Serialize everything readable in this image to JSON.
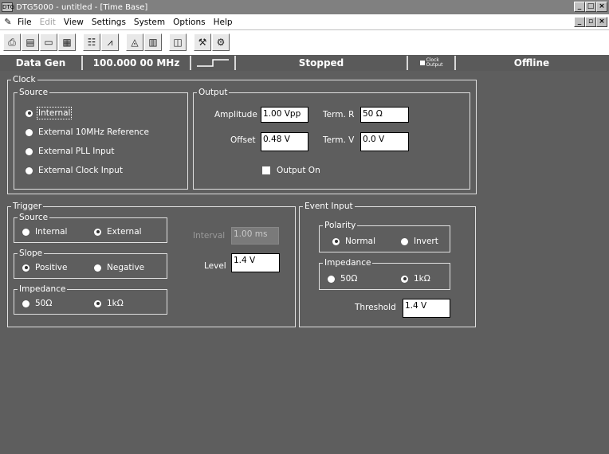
{
  "window": {
    "title": "DTG5000 - untitled - [Time Base]",
    "app_icon": "DTG",
    "controls": [
      "_",
      "□",
      "×"
    ],
    "mdi_controls": [
      "_",
      "▫",
      "×"
    ]
  },
  "menu": [
    {
      "label": "File",
      "enabled": true
    },
    {
      "label": "Edit",
      "enabled": false
    },
    {
      "label": "View",
      "enabled": true
    },
    {
      "label": "Settings",
      "enabled": true
    },
    {
      "label": "System",
      "enabled": true
    },
    {
      "label": "Options",
      "enabled": true
    },
    {
      "label": "Help",
      "enabled": true
    }
  ],
  "toolbar": {
    "icons": [
      "printer-icon",
      "print-preview-icon",
      "open-icon",
      "grid-icon",
      "channel-list-icon",
      "waveform-icon",
      "pattern-editor-icon",
      "sequence-icon",
      "blocks-icon",
      "tools-icon",
      "wrench-icon"
    ]
  },
  "status": {
    "mode": "Data Gen",
    "frequency": "100.000 00 MHz",
    "run_state": "Stopped",
    "clock_output_line1": "Clock",
    "clock_output_line2": "Output",
    "connection": "Offline"
  },
  "clock": {
    "legend": "Clock",
    "source": {
      "legend": "Source",
      "options": [
        "Internal",
        "External 10MHz Reference",
        "External PLL Input",
        "External Clock Input"
      ],
      "selected": 0
    },
    "output": {
      "legend": "Output",
      "amplitude_label": "Amplitude",
      "amplitude_value": "1.00 Vpp",
      "term_r_label": "Term. R",
      "term_r_value": "50 Ω",
      "offset_label": "Offset",
      "offset_value": "0.48 V",
      "term_v_label": "Term. V",
      "term_v_value": "0.0 V",
      "output_on_label": "Output On",
      "output_on": false
    }
  },
  "trigger": {
    "legend": "Trigger",
    "source": {
      "legend": "Source",
      "options": [
        "Internal",
        "External"
      ],
      "selected": 1
    },
    "slope": {
      "legend": "Slope",
      "options": [
        "Positive",
        "Negative"
      ],
      "selected": 0
    },
    "impedance": {
      "legend": "Impedance",
      "options": [
        "50Ω",
        "1kΩ"
      ],
      "selected": 1
    },
    "interval_label": "Interval",
    "interval_value": "1.00 ms",
    "level_label": "Level",
    "level_value": "1.4 V"
  },
  "event_input": {
    "legend": "Event Input",
    "polarity": {
      "legend": "Polarity",
      "options": [
        "Normal",
        "Invert"
      ],
      "selected": 0
    },
    "impedance": {
      "legend": "Impedance",
      "options": [
        "50Ω",
        "1kΩ"
      ],
      "selected": 1
    },
    "threshold_label": "Threshold",
    "threshold_value": "1.4 V"
  }
}
